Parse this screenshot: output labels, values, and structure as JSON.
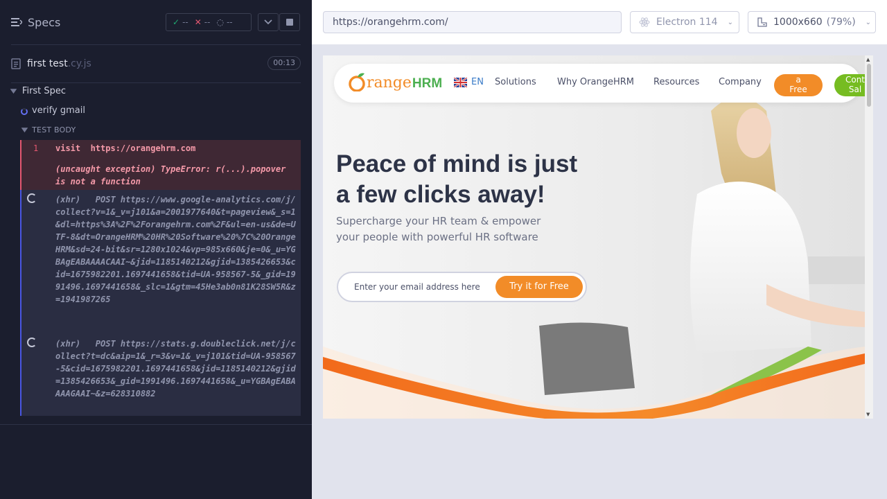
{
  "reporter": {
    "specs_label": "Specs",
    "stats": {
      "passed": "--",
      "failed": "--",
      "pending": "--"
    },
    "spec_file": {
      "name": "first test",
      "ext": ".cy.js",
      "duration": "00:13"
    },
    "suite": "First Spec",
    "test": "verify gmail",
    "section": "TEST BODY",
    "commands": [
      {
        "num": "1",
        "name": "visit",
        "arg": "https://orangehrm.com",
        "error": "(uncaught exception)  TypeError: r(...).popover is not a function"
      },
      {
        "text": "(xhr)   POST https://www.google-analytics.com/j/collect?v=1&_v=j101&a=2001977640&t=pageview&_s=1&dl=https%3A%2F%2Forangehrm.com%2F&ul=en-us&de=UTF-8&dt=OrangeHRM%20HR%20Software%20%7C%20OrangeHRM&sd=24-bit&sr=1280x1024&vp=985x660&je=0&_u=YGBAgEABAAAACAAI~&jid=1185140212&gjid=1385426653&cid=1675982201.1697441658&tid=UA-958567-5&_gid=1991496.1697441658&_slc=1&gtm=45He3ab0n81K28SW5R&z=1941987265"
      },
      {
        "text": "(xhr)   POST https://stats.g.doubleclick.net/j/collect?t=dc&aip=1&_r=3&v=1&_v=j101&tid=UA-958567-5&cid=1675982201.1697441658&jid=1185140212&gjid=1385426653&_gid=1991496.1697441658&_u=YGBAgEABAAAAGAAI~&z=628310882"
      }
    ]
  },
  "aut": {
    "url": "https://orangehrm.com/",
    "browser": "Electron 114",
    "viewport": "1000x660",
    "zoom": "(79%)"
  },
  "site": {
    "logo": {
      "o": "O",
      "range": "range",
      "hrm": "HRM"
    },
    "lang": "EN",
    "nav": [
      "Solutions",
      "Why OrangeHRM",
      "Resources",
      "Company"
    ],
    "demo_button": "a\nFree",
    "sales_button": "Cont\nSal",
    "hero_title": "Peace of mind is just a few clicks away!",
    "hero_sub": "Supercharge your HR team & empower your people with powerful HR software",
    "email_placeholder": "Enter your email address here",
    "try_button": "Try it for Free"
  },
  "colors": {
    "reporter_bg": "#1b1e2e",
    "fail_red": "#e45770",
    "pending_blue": "#4956e3",
    "orange": "#f28c28",
    "green": "#76bc21"
  }
}
